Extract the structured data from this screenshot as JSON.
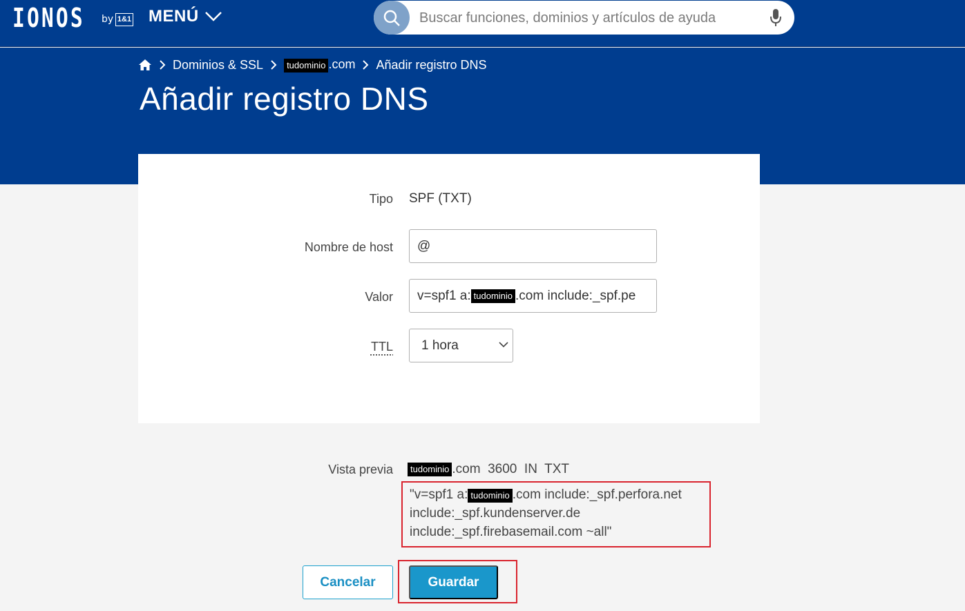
{
  "header": {
    "logo_text": "IONOS",
    "logo_by": "by",
    "logo_brand": "1&1",
    "menu_label": "MENÚ",
    "search_placeholder": "Buscar funciones, dominios y artículos de ayuda",
    "colors": {
      "primary": "#003d8f",
      "search_button": "#7fa2c9"
    }
  },
  "breadcrumb": {
    "items": [
      "Dominios & SSL",
      "Añadir registro DNS"
    ],
    "domain_redacted": "tudominio",
    "domain_suffix": ".com"
  },
  "page_title": "Añadir registro DNS",
  "form": {
    "tipo_label": "Tipo",
    "tipo_value": "SPF (TXT)",
    "host_label": "Nombre de host",
    "host_value": "@",
    "valor_label": "Valor",
    "valor_prefix": "v=spf1 a:",
    "valor_redacted": "tudominio",
    "valor_suffix": ".com include:_spf.pe",
    "ttl_label": "TTL",
    "ttl_value": "1 hora"
  },
  "preview": {
    "label": "Vista previa",
    "domain_redacted": "tudominio",
    "head_suffix": ".com  3600  IN  TXT",
    "line1_prefix": "\"v=spf1 a:",
    "line1_redacted": "tudominio",
    "line1_suffix": ".com include:_spf.perfora.net",
    "line2": "include:_spf.kundenserver.de",
    "line3": "include:_spf.firebasemail.com ~all\""
  },
  "actions": {
    "cancel_label": "Cancelar",
    "save_label": "Guardar",
    "colors": {
      "highlight": "#d9232d",
      "save": "#1a97cb"
    }
  }
}
